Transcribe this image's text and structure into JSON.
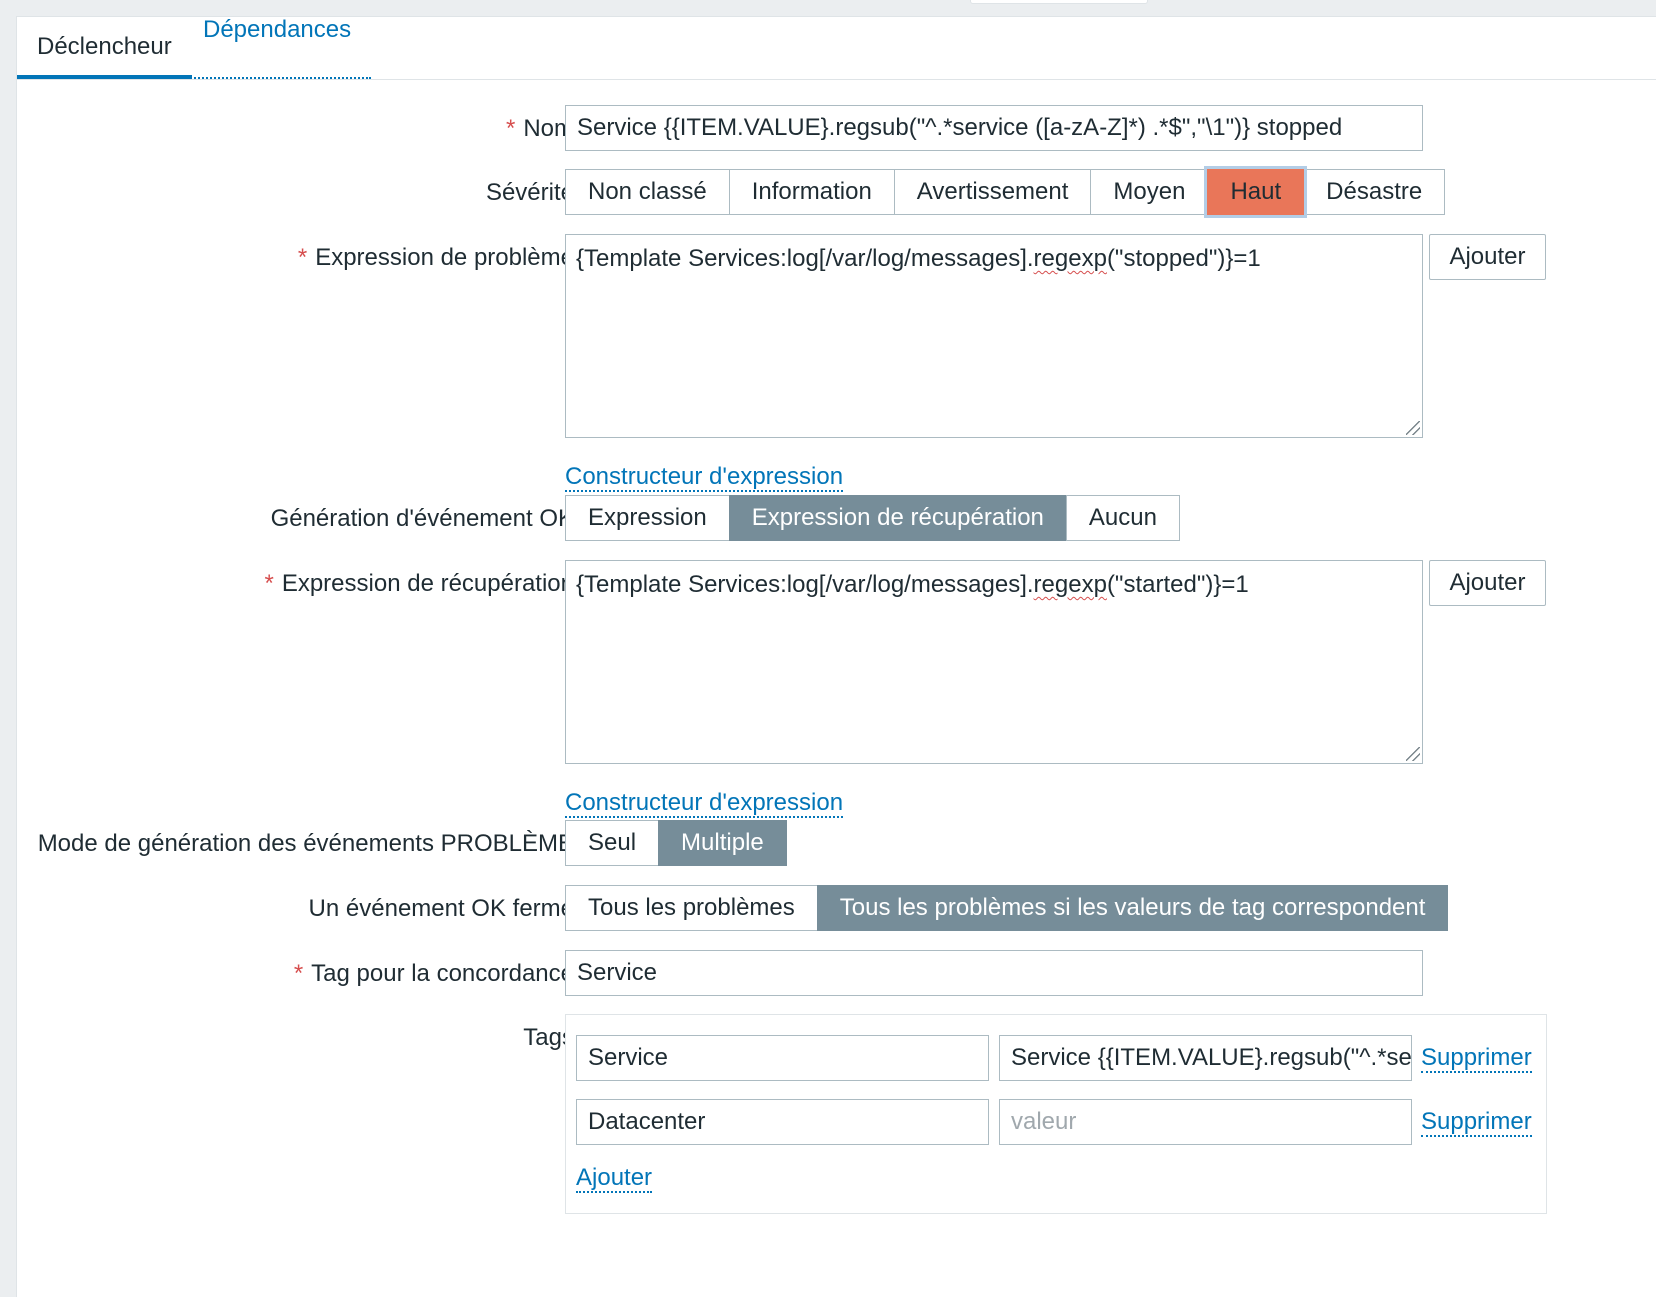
{
  "tabs": [
    {
      "label": "Déclencheur"
    },
    {
      "label": "Dépendances"
    }
  ],
  "form": {
    "name": {
      "label": "Nom",
      "value": "Service {{ITEM.VALUE}.regsub(\"^.*service ([a-zA-Z]*) .*$\",\"\\1\")} stopped"
    },
    "severity": {
      "label": "Sévérité",
      "options": [
        "Non classé",
        "Information",
        "Avertissement",
        "Moyen",
        "Haut",
        "Désastre"
      ],
      "selected": "Haut",
      "selected_color": "#e97659"
    },
    "problem_expression": {
      "label": "Expression de problème",
      "value_pre": "{Template Services:log[/var/log/messages].",
      "value_fn": "regexp",
      "value_post": "(\"stopped\")}=1",
      "add_label": "Ajouter",
      "builder_link": "Constructeur d'expression"
    },
    "ok_event_generation": {
      "label": "Génération d'événement OK",
      "options": [
        "Expression",
        "Expression de récupération",
        "Aucun"
      ],
      "selected": "Expression de récupération"
    },
    "recovery_expression": {
      "label": "Expression de récupération",
      "value_pre": "{Template Services:log[/var/log/messages].",
      "value_fn": "regexp",
      "value_post": "(\"started\")}=1",
      "add_label": "Ajouter",
      "builder_link": "Constructeur d'expression"
    },
    "problem_event_mode": {
      "label": "Mode de génération des événements PROBLÈME",
      "options": [
        "Seul",
        "Multiple"
      ],
      "selected": "Multiple"
    },
    "ok_event_closes": {
      "label": "Un événement OK ferme",
      "options": [
        "Tous les problèmes",
        "Tous les problèmes si les valeurs de tag correspondent"
      ],
      "selected": "Tous les problèmes si les valeurs de tag correspondent"
    },
    "match_tag": {
      "label": "Tag pour la concordance",
      "value": "Service"
    },
    "tags": {
      "label": "Tags",
      "rows": [
        {
          "tag": "Service",
          "value": "Service {{ITEM.VALUE}.regsub(\"^.*ser",
          "remove": "Supprimer"
        },
        {
          "tag": "Datacenter",
          "value": "",
          "value_placeholder": "valeur",
          "remove": "Supprimer"
        }
      ],
      "add_label": "Ajouter"
    }
  },
  "colors": {
    "accent": "#0275b8",
    "selected_segment": "#768d99",
    "required": "#d64e4e"
  }
}
